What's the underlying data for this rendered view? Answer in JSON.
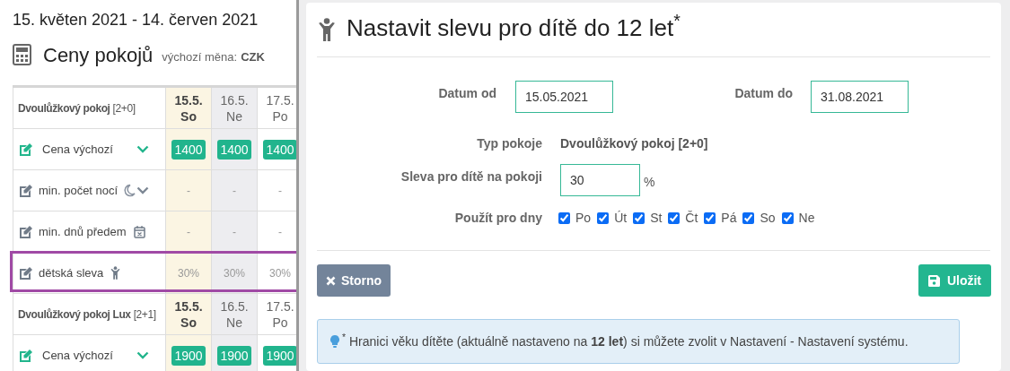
{
  "date_range": "15. květen 2021 - 14. červen 2021",
  "section": {
    "title": "Ceny pokojů",
    "currency_label": "výchozí měna:",
    "currency": "CZK"
  },
  "rooms": [
    {
      "name": "Dvoulůžkový pokoj",
      "capacity": "[2+0]",
      "days": [
        {
          "date": "15.5.",
          "weekday": "So",
          "kind": "selected"
        },
        {
          "date": "16.5.",
          "weekday": "Ne",
          "kind": "holiday"
        },
        {
          "date": "17.5.",
          "weekday": "Po",
          "kind": "normal"
        }
      ],
      "rows": [
        {
          "label": "Cena výchozí",
          "kind": "price",
          "expandable": true,
          "highlighted": false,
          "values": [
            "1400",
            "1400",
            "1400"
          ]
        },
        {
          "label": "min. počet nocí",
          "kind": "min_nights",
          "expandable": true,
          "highlighted": false,
          "values": [
            "-",
            "-",
            "-"
          ]
        },
        {
          "label": "min. dnů předem",
          "kind": "min_advance",
          "expandable": false,
          "highlighted": false,
          "values": [
            "-",
            "-",
            "-"
          ]
        },
        {
          "label": "dětská sleva",
          "kind": "child_discount",
          "expandable": false,
          "highlighted": true,
          "values": [
            "30%",
            "30%",
            "30%"
          ]
        }
      ]
    },
    {
      "name": "Dvoulůžkový pokoj Lux",
      "capacity": "[2+1]",
      "days": [
        {
          "date": "15.5.",
          "weekday": "So",
          "kind": "selected"
        },
        {
          "date": "16.5.",
          "weekday": "Ne",
          "kind": "holiday"
        },
        {
          "date": "17.5.",
          "weekday": "Po",
          "kind": "normal"
        }
      ],
      "rows": [
        {
          "label": "Cena výchozí",
          "kind": "price",
          "expandable": true,
          "highlighted": false,
          "values": [
            "1900",
            "1900",
            "1900"
          ]
        }
      ]
    }
  ],
  "dialog": {
    "title": "Nastavit slevu pro dítě do 12 let$^{*}$",
    "date_from": {
      "label": "Datum od",
      "value": "15.05.2021"
    },
    "date_to": {
      "label": "Datum do",
      "value": "31.08.2021"
    },
    "room_type": {
      "label": "Typ pokoje",
      "value": "Dvoulůžkový pokoj [2+0]"
    },
    "discount": {
      "label": "Sleva pro dítě na pokoji",
      "value": "30",
      "unit": "%"
    },
    "days": {
      "label": "Použít pro dny",
      "items": [
        {
          "label": "Po",
          "checked": true
        },
        {
          "label": "Út",
          "checked": true
        },
        {
          "label": "St",
          "checked": true
        },
        {
          "label": "Čt",
          "checked": true
        },
        {
          "label": "Pá",
          "checked": true
        },
        {
          "label": "So",
          "checked": true
        },
        {
          "label": "Ne",
          "checked": true
        }
      ]
    },
    "cancel_button": "Storno",
    "save_button": "Uložit",
    "note": "$^{*}$ Hranici věku dítěte (aktuálně nastaveno na **12 let**) si můžete zvolit v Nastavení - Nastavení systému."
  }
}
